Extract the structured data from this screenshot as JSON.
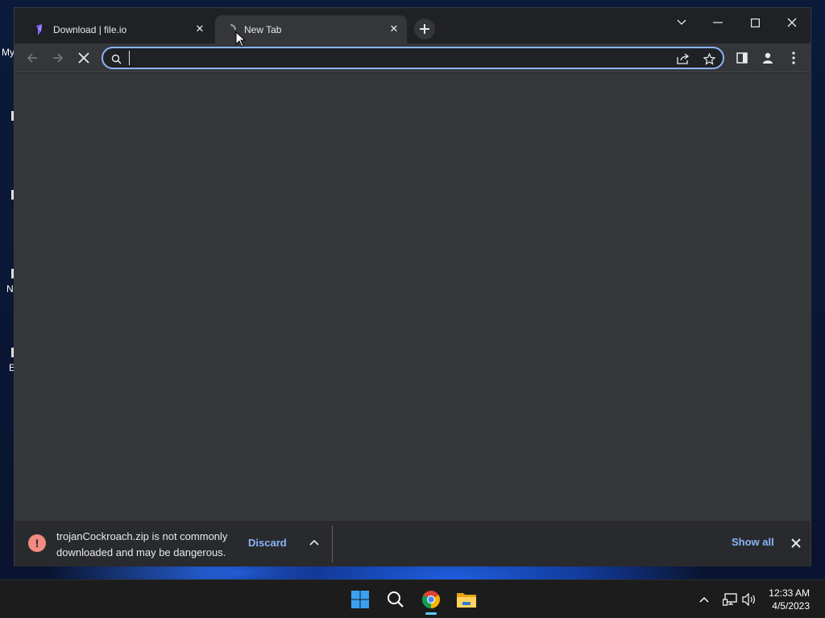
{
  "desktop": {
    "labels": [
      "My",
      "N",
      "E"
    ]
  },
  "browser": {
    "tabs": [
      {
        "title": "Download | file.io",
        "active": false,
        "favicon": "file-io-icon"
      },
      {
        "title": "New Tab",
        "active": true,
        "favicon": "loading-spinner-icon"
      }
    ],
    "window_controls": [
      "tab-search-icon",
      "minimize-icon",
      "maximize-icon",
      "close-icon"
    ],
    "toolbar": {
      "back": "back-arrow-icon",
      "forward": "forward-arrow-icon",
      "stop": "stop-loading-icon",
      "omnibox_value": "",
      "omnibox_icons": [
        "search-icon",
        "share-icon",
        "star-icon"
      ],
      "right_icons": [
        "side-panel-icon",
        "profile-icon",
        "kebab-menu-icon"
      ]
    },
    "download_bar": {
      "message_line1": "trojanCockroach.zip is not commonly",
      "message_line2": "downloaded and may be dangerous.",
      "discard_label": "Discard",
      "show_all_label": "Show all"
    },
    "accent_color": "#8ab4f8",
    "warning_color": "#f28b82"
  },
  "taskbar": {
    "apps": [
      "windows-start-icon",
      "search-icon",
      "chrome-icon",
      "file-explorer-icon"
    ],
    "tray": [
      "chevron-up-icon",
      "network-icon",
      "volume-icon"
    ],
    "time": "12:33 AM",
    "date": "4/5/2023"
  }
}
